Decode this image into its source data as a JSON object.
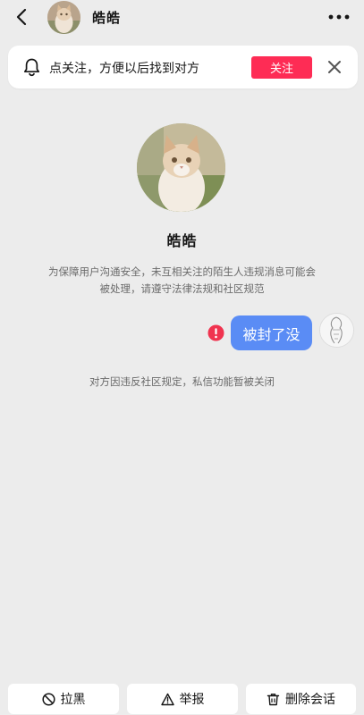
{
  "header": {
    "name": "皓皓",
    "icons": {
      "back": "back-arrow-icon",
      "more": "more-dots-icon"
    }
  },
  "banner": {
    "text": "点关注，方便以后找到对方",
    "follow_label": "关注",
    "icons": {
      "bell": "bell-icon",
      "close": "close-icon"
    },
    "accent": "#fe2c55"
  },
  "profile": {
    "name": "皓皓",
    "notice": "为保障用户沟通安全，未互相关注的陌生人违规消息可能会被处理，请遵守法律法规和社区规范"
  },
  "messages": [
    {
      "text": "被封了没",
      "status": "failed",
      "status_icon": "error-icon",
      "bubble_color": "#5a8cf5"
    }
  ],
  "system_message": "对方因违反社区规定，私信功能暂被关闭",
  "actions": [
    {
      "label": "拉黑",
      "icon": "block-icon"
    },
    {
      "label": "举报",
      "icon": "warning-icon"
    },
    {
      "label": "删除会话",
      "icon": "trash-icon"
    }
  ]
}
